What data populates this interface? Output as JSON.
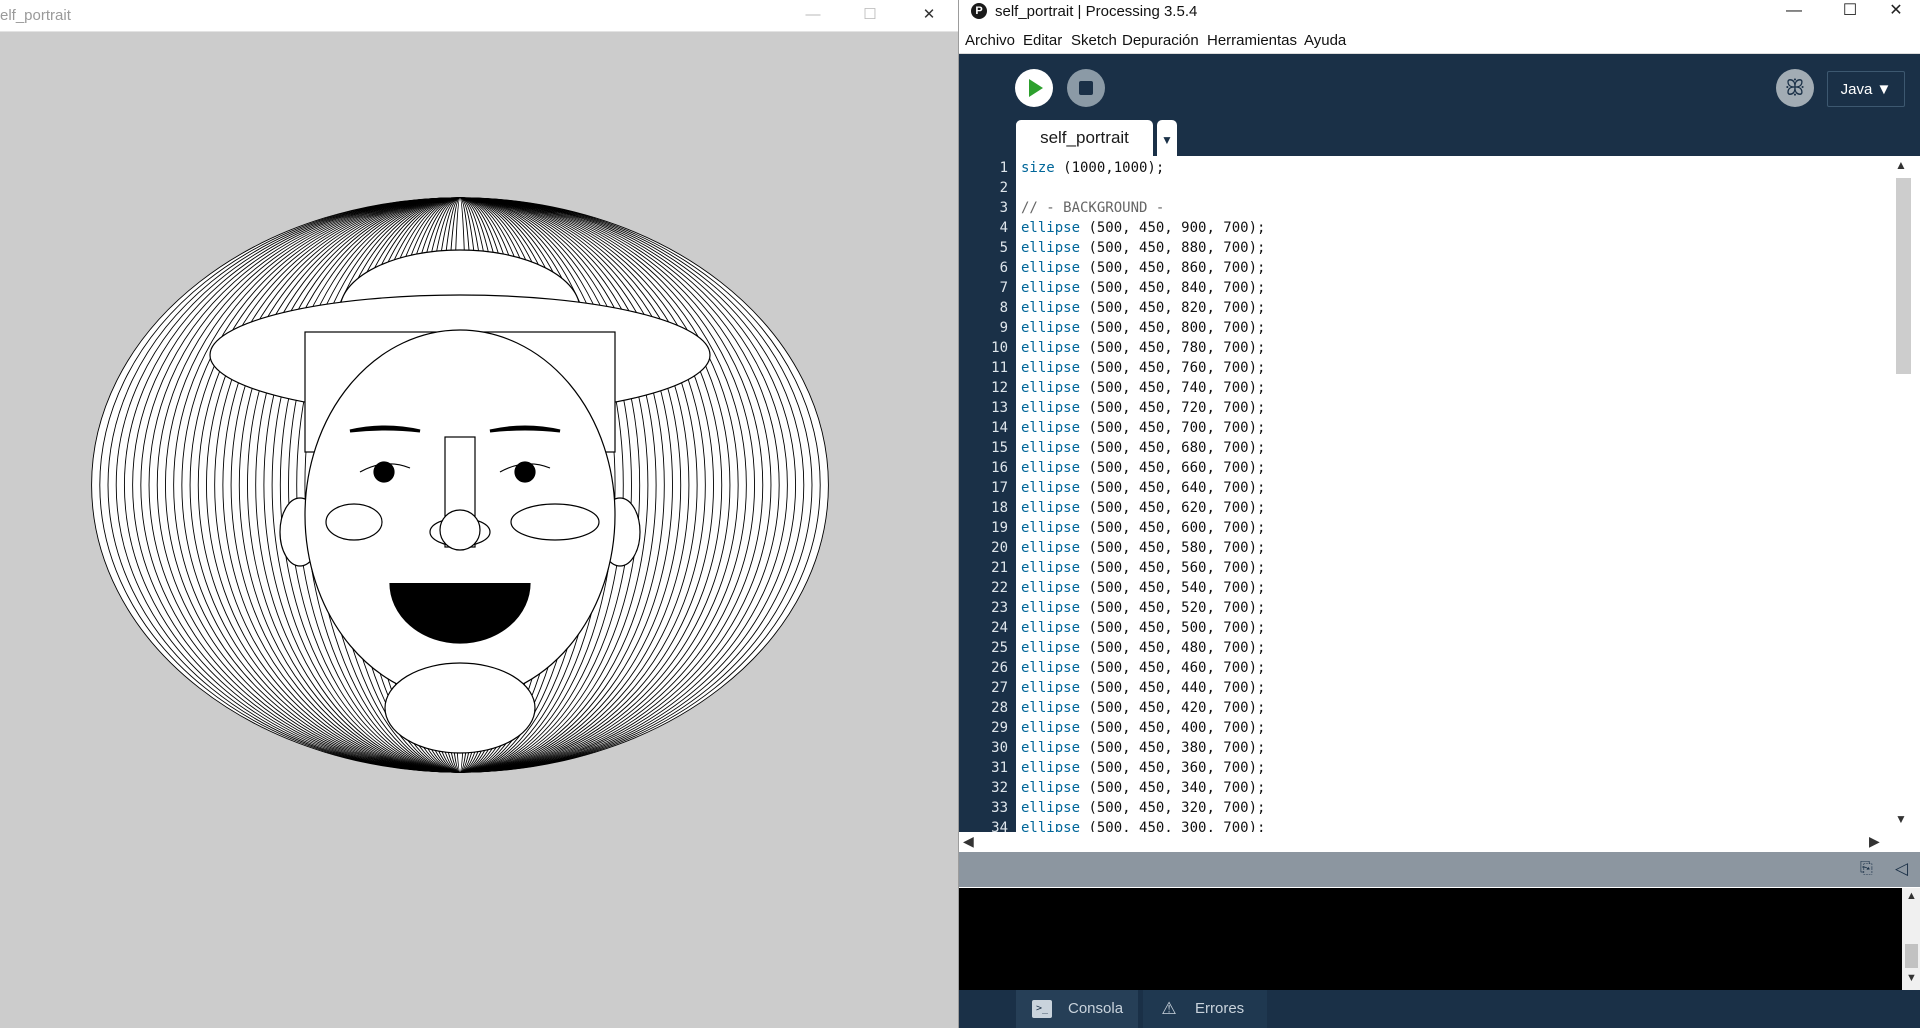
{
  "sketch_window": {
    "title": "elf_portrait",
    "controls": {
      "minimize": "—",
      "maximize": "☐",
      "close": "✕"
    }
  },
  "ide_window": {
    "app_icon": "P",
    "title": "self_portrait | Processing 3.5.4",
    "controls": {
      "minimize": "—",
      "maximize": "☐",
      "close": "✕"
    }
  },
  "menubar": {
    "items": [
      "Archivo",
      "Editar",
      "Sketch",
      "Depuración",
      "Herramientas",
      "Ayuda"
    ]
  },
  "toolbar": {
    "run_icon": "play-icon",
    "stop_icon": "stop-icon",
    "debug_icon": "butterfly-icon",
    "debug_glyph": "ꕥ",
    "mode_label": "Java ▼"
  },
  "tabs": {
    "active": "self_portrait",
    "menu_glyph": "▼"
  },
  "editor": {
    "lines": [
      {
        "n": "1",
        "kw": "size",
        "rest": " (1000,1000);"
      },
      {
        "n": "2",
        "kw": "",
        "rest": ""
      },
      {
        "n": "3",
        "comment": "// - BACKGROUND -"
      },
      {
        "n": "4",
        "kw": "ellipse",
        "rest": " (500, 450, 900, 700);"
      },
      {
        "n": "5",
        "kw": "ellipse",
        "rest": " (500, 450, 880, 700);"
      },
      {
        "n": "6",
        "kw": "ellipse",
        "rest": " (500, 450, 860, 700);"
      },
      {
        "n": "7",
        "kw": "ellipse",
        "rest": " (500, 450, 840, 700);"
      },
      {
        "n": "8",
        "kw": "ellipse",
        "rest": " (500, 450, 820, 700);"
      },
      {
        "n": "9",
        "kw": "ellipse",
        "rest": " (500, 450, 800, 700);"
      },
      {
        "n": "10",
        "kw": "ellipse",
        "rest": " (500, 450, 780, 700);"
      },
      {
        "n": "11",
        "kw": "ellipse",
        "rest": " (500, 450, 760, 700);"
      },
      {
        "n": "12",
        "kw": "ellipse",
        "rest": " (500, 450, 740, 700);"
      },
      {
        "n": "13",
        "kw": "ellipse",
        "rest": " (500, 450, 720, 700);"
      },
      {
        "n": "14",
        "kw": "ellipse",
        "rest": " (500, 450, 700, 700);"
      },
      {
        "n": "15",
        "kw": "ellipse",
        "rest": " (500, 450, 680, 700);"
      },
      {
        "n": "16",
        "kw": "ellipse",
        "rest": " (500, 450, 660, 700);"
      },
      {
        "n": "17",
        "kw": "ellipse",
        "rest": " (500, 450, 640, 700);"
      },
      {
        "n": "18",
        "kw": "ellipse",
        "rest": " (500, 450, 620, 700);"
      },
      {
        "n": "19",
        "kw": "ellipse",
        "rest": " (500, 450, 600, 700);"
      },
      {
        "n": "20",
        "kw": "ellipse",
        "rest": " (500, 450, 580, 700);"
      },
      {
        "n": "21",
        "kw": "ellipse",
        "rest": " (500, 450, 560, 700);"
      },
      {
        "n": "22",
        "kw": "ellipse",
        "rest": " (500, 450, 540, 700);"
      },
      {
        "n": "23",
        "kw": "ellipse",
        "rest": " (500, 450, 520, 700);"
      },
      {
        "n": "24",
        "kw": "ellipse",
        "rest": " (500, 450, 500, 700);"
      },
      {
        "n": "25",
        "kw": "ellipse",
        "rest": " (500, 450, 480, 700);"
      },
      {
        "n": "26",
        "kw": "ellipse",
        "rest": " (500, 450, 460, 700);"
      },
      {
        "n": "27",
        "kw": "ellipse",
        "rest": " (500, 450, 440, 700);"
      },
      {
        "n": "28",
        "kw": "ellipse",
        "rest": " (500, 450, 420, 700);"
      },
      {
        "n": "29",
        "kw": "ellipse",
        "rest": " (500, 450, 400, 700);"
      },
      {
        "n": "30",
        "kw": "ellipse",
        "rest": " (500, 450, 380, 700);"
      },
      {
        "n": "31",
        "kw": "ellipse",
        "rest": " (500, 450, 360, 700);"
      },
      {
        "n": "32",
        "kw": "ellipse",
        "rest": " (500, 450, 340, 700);"
      },
      {
        "n": "33",
        "kw": "ellipse",
        "rest": " (500, 450, 320, 700);"
      },
      {
        "n": "34",
        "kw": "ellipse",
        "rest": " (500, 450, 300, 700);"
      }
    ]
  },
  "console_toolbar": {
    "copy_icon": "copy-icon",
    "copy_glyph": "⎘",
    "collapse_icon": "collapse-triangle-icon",
    "collapse_glyph": "◁"
  },
  "footer": {
    "console_label": "Consola",
    "console_glyph": ">_",
    "errors_label": "Errores",
    "errors_glyph": "⚠"
  },
  "colors": {
    "ide_dark": "#1a3047",
    "keyword": "#006699",
    "comment": "#666666",
    "sketch_bg": "#cccccc",
    "run_green": "#2da02d"
  }
}
